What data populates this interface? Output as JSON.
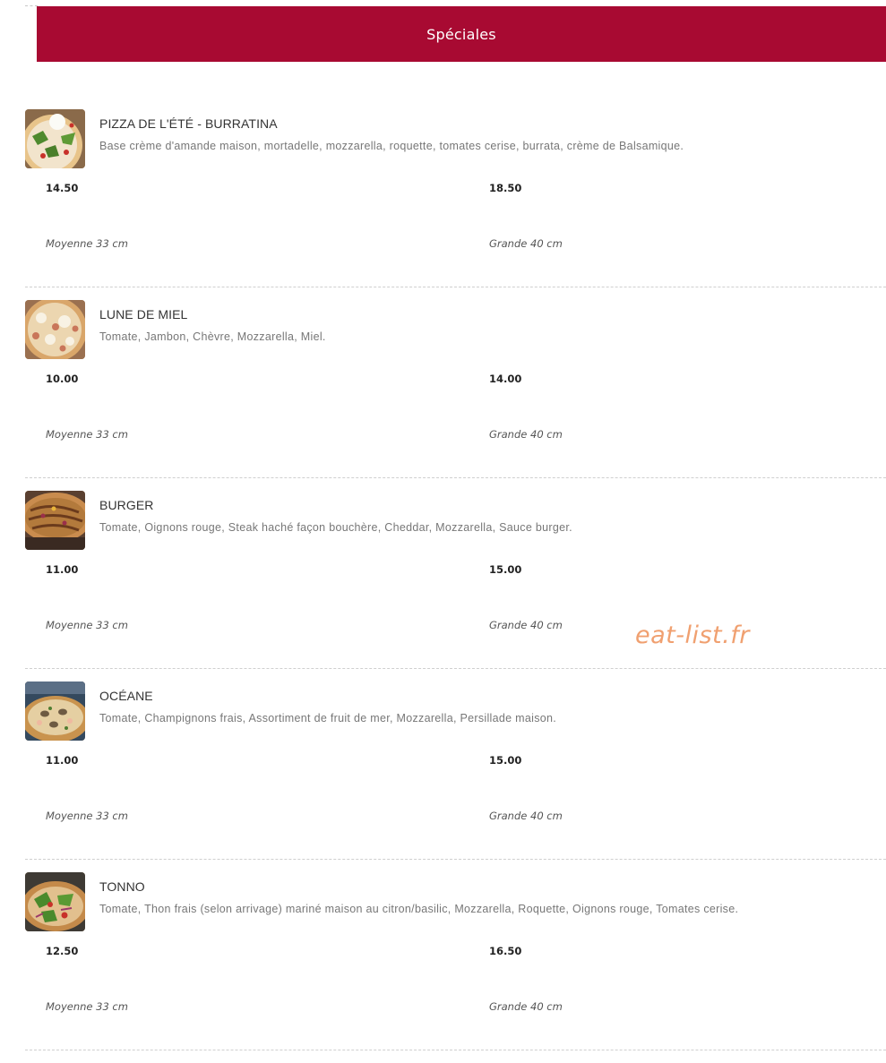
{
  "section": {
    "title": "Spéciales"
  },
  "items": [
    {
      "name": "PIZZA DE L'ÉTÉ - BURRATINA",
      "description": "Base crème d'amande maison, mortadelle, mozzarella, roquette, tomates cerise, burrata, crème de Balsamique.",
      "prices": [
        {
          "price": "14.50",
          "size": "Moyenne 33 cm"
        },
        {
          "price": "18.50",
          "size": "Grande 40 cm"
        }
      ]
    },
    {
      "name": "LUNE DE MIEL",
      "description": "Tomate, Jambon, Chèvre, Mozzarella, Miel.",
      "prices": [
        {
          "price": "10.00",
          "size": "Moyenne 33 cm"
        },
        {
          "price": "14.00",
          "size": "Grande 40 cm"
        }
      ]
    },
    {
      "name": "BURGER",
      "description": "Tomate, Oignons rouge, Steak haché façon bouchère, Cheddar, Mozzarella, Sauce burger.",
      "prices": [
        {
          "price": "11.00",
          "size": "Moyenne 33 cm"
        },
        {
          "price": "15.00",
          "size": "Grande 40 cm"
        }
      ]
    },
    {
      "name": "OCÉANE",
      "description": "Tomate, Champignons frais, Assortiment de fruit de mer, Mozzarella, Persillade maison.",
      "prices": [
        {
          "price": "11.00",
          "size": "Moyenne 33 cm"
        },
        {
          "price": "15.00",
          "size": "Grande 40 cm"
        }
      ]
    },
    {
      "name": "TONNO",
      "description": "Tomate, Thon frais (selon arrivage) mariné maison au citron/basilic, Mozzarella, Roquette, Oignons rouge, Tomates cerise.",
      "prices": [
        {
          "price": "12.50",
          "size": "Moyenne 33 cm"
        },
        {
          "price": "16.50",
          "size": "Grande 40 cm"
        }
      ]
    }
  ],
  "watermark": "eat-list.fr",
  "colors": {
    "header_bg": "#a80a32",
    "header_text": "#ffffff",
    "watermark": "#f0a070"
  }
}
